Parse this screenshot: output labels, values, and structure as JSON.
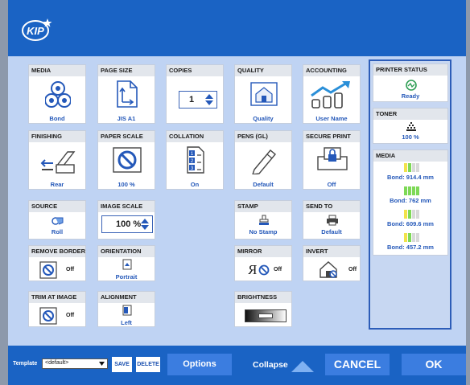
{
  "app": {
    "logo_text": "KIP"
  },
  "cards": {
    "media": {
      "title": "MEDIA",
      "value": "Bond"
    },
    "page_size": {
      "title": "PAGE SIZE",
      "value": "JIS A1"
    },
    "copies": {
      "title": "COPIES",
      "value": "1"
    },
    "quality": {
      "title": "QUALITY",
      "value": "Quality"
    },
    "accounting": {
      "title": "ACCOUNTING",
      "value": "User Name"
    },
    "finishing": {
      "title": "FINISHING",
      "value": "Rear"
    },
    "paper_scale": {
      "title": "PAPER SCALE",
      "value": "100 %"
    },
    "collation": {
      "title": "COLLATION",
      "value": "On",
      "icon_digits": [
        "1",
        "2",
        "3"
      ]
    },
    "pens": {
      "title": "PENS (GL)",
      "value": "Default"
    },
    "secure_print": {
      "title": "SECURE PRINT",
      "value": "Off"
    },
    "source": {
      "title": "SOURCE",
      "value": "Roll"
    },
    "image_scale": {
      "title": "IMAGE SCALE",
      "value": "100 %"
    },
    "stamp": {
      "title": "STAMP",
      "value": "No Stamp"
    },
    "send_to": {
      "title": "SEND TO",
      "value": "Default"
    },
    "remove_borders": {
      "title": "REMOVE BORDERS",
      "value": "Off"
    },
    "orientation": {
      "title": "ORIENTATION",
      "value": "Portrait"
    },
    "mirror": {
      "title": "MIRROR",
      "value": "Off",
      "glyph": "R"
    },
    "invert": {
      "title": "INVERT",
      "value": "Off"
    },
    "trim": {
      "title": "TRIM AT IMAGE",
      "value": "Off"
    },
    "alignment": {
      "title": "ALIGNMENT",
      "value": "Left"
    },
    "brightness": {
      "title": "BRIGHTNESS",
      "level": 0.5
    }
  },
  "status": {
    "printer_title": "PRINTER STATUS",
    "printer_value": "Ready",
    "toner_title": "TONER",
    "toner_value": "100 %",
    "toner_level": 1.0,
    "media_title": "MEDIA",
    "rolls": [
      {
        "label": "Bond: 914.4 mm",
        "level": 0.5
      },
      {
        "label": "Bond: 762 mm",
        "level": 1.0
      },
      {
        "label": "Bond: 609.6 mm",
        "level": 0.5
      },
      {
        "label": "Bond: 457.2 mm",
        "level": 0.5
      }
    ]
  },
  "footer": {
    "template_label": "Template",
    "template_value": "<default>",
    "save_label": "SAVE",
    "delete_label": "DELETE",
    "options_label": "Options",
    "collapse_label": "Collapse",
    "cancel_label": "CANCEL",
    "ok_label": "OK"
  },
  "colors": {
    "header": "#1a63c4",
    "accent": "#2458b9",
    "ready": "#2f9e55",
    "bar_green": "#7ed957",
    "bar_yellow": "#f2e24a",
    "bar_empty": "#d9d9d9"
  }
}
